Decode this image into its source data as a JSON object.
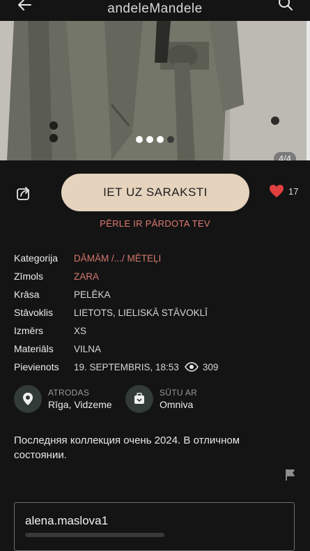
{
  "header": {
    "logo": "andeleMandele",
    "back_icon": "arrow-left-icon",
    "search_icon": "search-icon"
  },
  "gallery": {
    "counter": "4/4",
    "total_images": 4,
    "active_index": 3
  },
  "actions": {
    "main_button": "IET UZ SARAKSTI",
    "likes": "17",
    "sold_text": "PĒRLE IR PĀRDOTA TEV",
    "accent_color": "#e5d3bd",
    "heart_color": "#e0413f"
  },
  "details": [
    {
      "label": "Kategorija",
      "value": "DĀMĀM /.../ MĒTEĻI"
    },
    {
      "label": "Zīmols",
      "value": "ZARA"
    },
    {
      "label": "Krāsa",
      "value": "PELĒKA"
    },
    {
      "label": "Stāvoklis",
      "value": "LIETOTS, LIELISKĀ STĀVOKLĪ"
    },
    {
      "label": "Izmērs",
      "value": "XS"
    },
    {
      "label": "Materiāls",
      "value": "VILNA"
    },
    {
      "label": "Pievienots",
      "value": "19. SEPTEMBRIS, 18:53"
    }
  ],
  "views": "309",
  "location": {
    "label": "ATRODAS",
    "value": "Rīga, Vidzeme"
  },
  "shipping": {
    "label": "SŪTU AR",
    "value": "Omniva"
  },
  "description": "Последняя коллекция очень 2024. В отличном состоянии.",
  "seller": {
    "username": "alena.maslova1"
  }
}
